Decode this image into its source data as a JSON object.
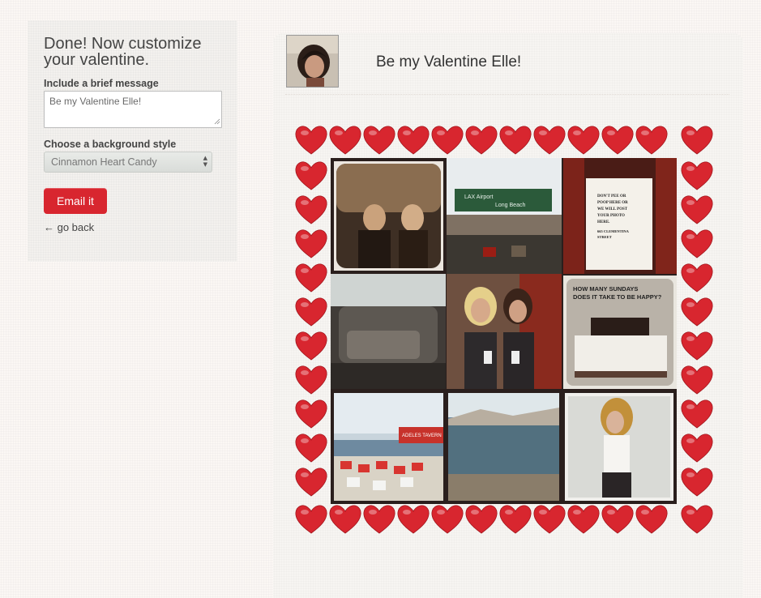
{
  "form": {
    "heading": "Done! Now customize your valentine.",
    "message_label": "Include a brief message",
    "message_value": "Be my Valentine Elle!",
    "background_label": "Choose a background style",
    "background_selected": "Cinnamon Heart Candy",
    "email_button": "Email it",
    "back_link": "← go back"
  },
  "valentine": {
    "title": "Be my Valentine Elle!",
    "border_style": "Cinnamon Heart Candy",
    "heart_color": "#d8262f",
    "photos": [
      {
        "caption": ""
      },
      {
        "caption": "LAX Airport  Long Beach"
      },
      {
        "caption": "DON'T PEE OR POOP HERE OR WE WILL POST YOUR PHOTO HERE.  665 CLEMENTINA STREET"
      },
      {
        "caption": ""
      },
      {
        "caption": ""
      },
      {
        "caption": "HOW MANY SUNDAYS DOES IT TAKE TO BE HAPPY?"
      },
      {
        "caption": "ADELES TAVERN"
      },
      {
        "caption": ""
      },
      {
        "caption": ""
      }
    ]
  },
  "colors": {
    "accent": "#d8262f",
    "background": "#fbf7f4"
  }
}
